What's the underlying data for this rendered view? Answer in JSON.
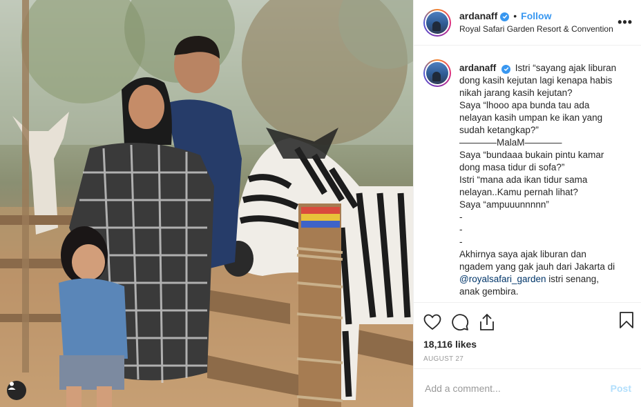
{
  "post": {
    "username": "ardanaff",
    "follow_label": "Follow",
    "separator": "•",
    "location": "Royal Safari Garden Resort & Convention",
    "more_icon": "more-horizontal-icon"
  },
  "caption": {
    "username": "ardanaff",
    "lines": [
      "Istri “sayang ajak liburan dong kasih kejutan lagi kenapa habis nikah jarang kasih kejutan?",
      "Saya “lhooo apa bunda tau ada nelayan kasih umpan ke ikan yang sudah ketangkap?”",
      "————MalaM————",
      "Saya “bundaaa bukain pintu kamar dong masa tidur di sofa?”",
      "Istri “mana ada ikan tidur sama nelayan..Kamu pernah lihat?",
      "Saya “ampuuunnnnn”",
      "-",
      "-",
      "-",
      "Akhirnya saya ajak liburan dan ngadem yang gak jauh dari Jakarta di"
    ],
    "mention": "@royalsafari_garden",
    "tail": " istri senang, anak gembira."
  },
  "actions": {
    "icons": [
      "heart-icon",
      "comment-icon",
      "share-icon",
      "bookmark-icon"
    ],
    "likes": "18,116 likes",
    "date": "AUGUST 27"
  },
  "comment_box": {
    "placeholder": "Add a comment...",
    "post_label": "Post"
  },
  "colors": {
    "link": "#3897f0",
    "post_disabled": "#b2dffc",
    "mention": "#003569"
  }
}
